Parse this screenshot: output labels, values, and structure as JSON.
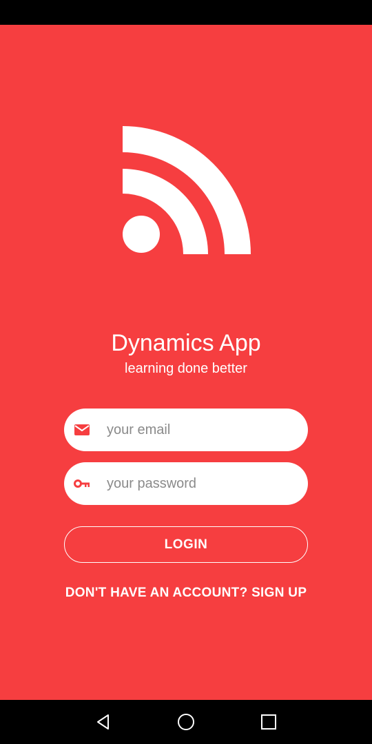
{
  "app": {
    "title": "Dynamics App",
    "subtitle": "learning done better"
  },
  "login_form": {
    "email": {
      "placeholder": "your email",
      "value": "",
      "icon": "email-icon"
    },
    "password": {
      "placeholder": "your password",
      "value": "",
      "icon": "key-icon"
    },
    "login_label": "LOGIN",
    "signup_label": "DON'T HAVE AN ACCOUNT? SIGN UP"
  },
  "navigation": {
    "back_icon": "back-triangle-icon",
    "home_icon": "home-circle-icon",
    "recent_icon": "recent-square-icon"
  },
  "colors": {
    "background": "#F63E40",
    "accent": "#F63E40",
    "text": "#FFFFFF"
  }
}
